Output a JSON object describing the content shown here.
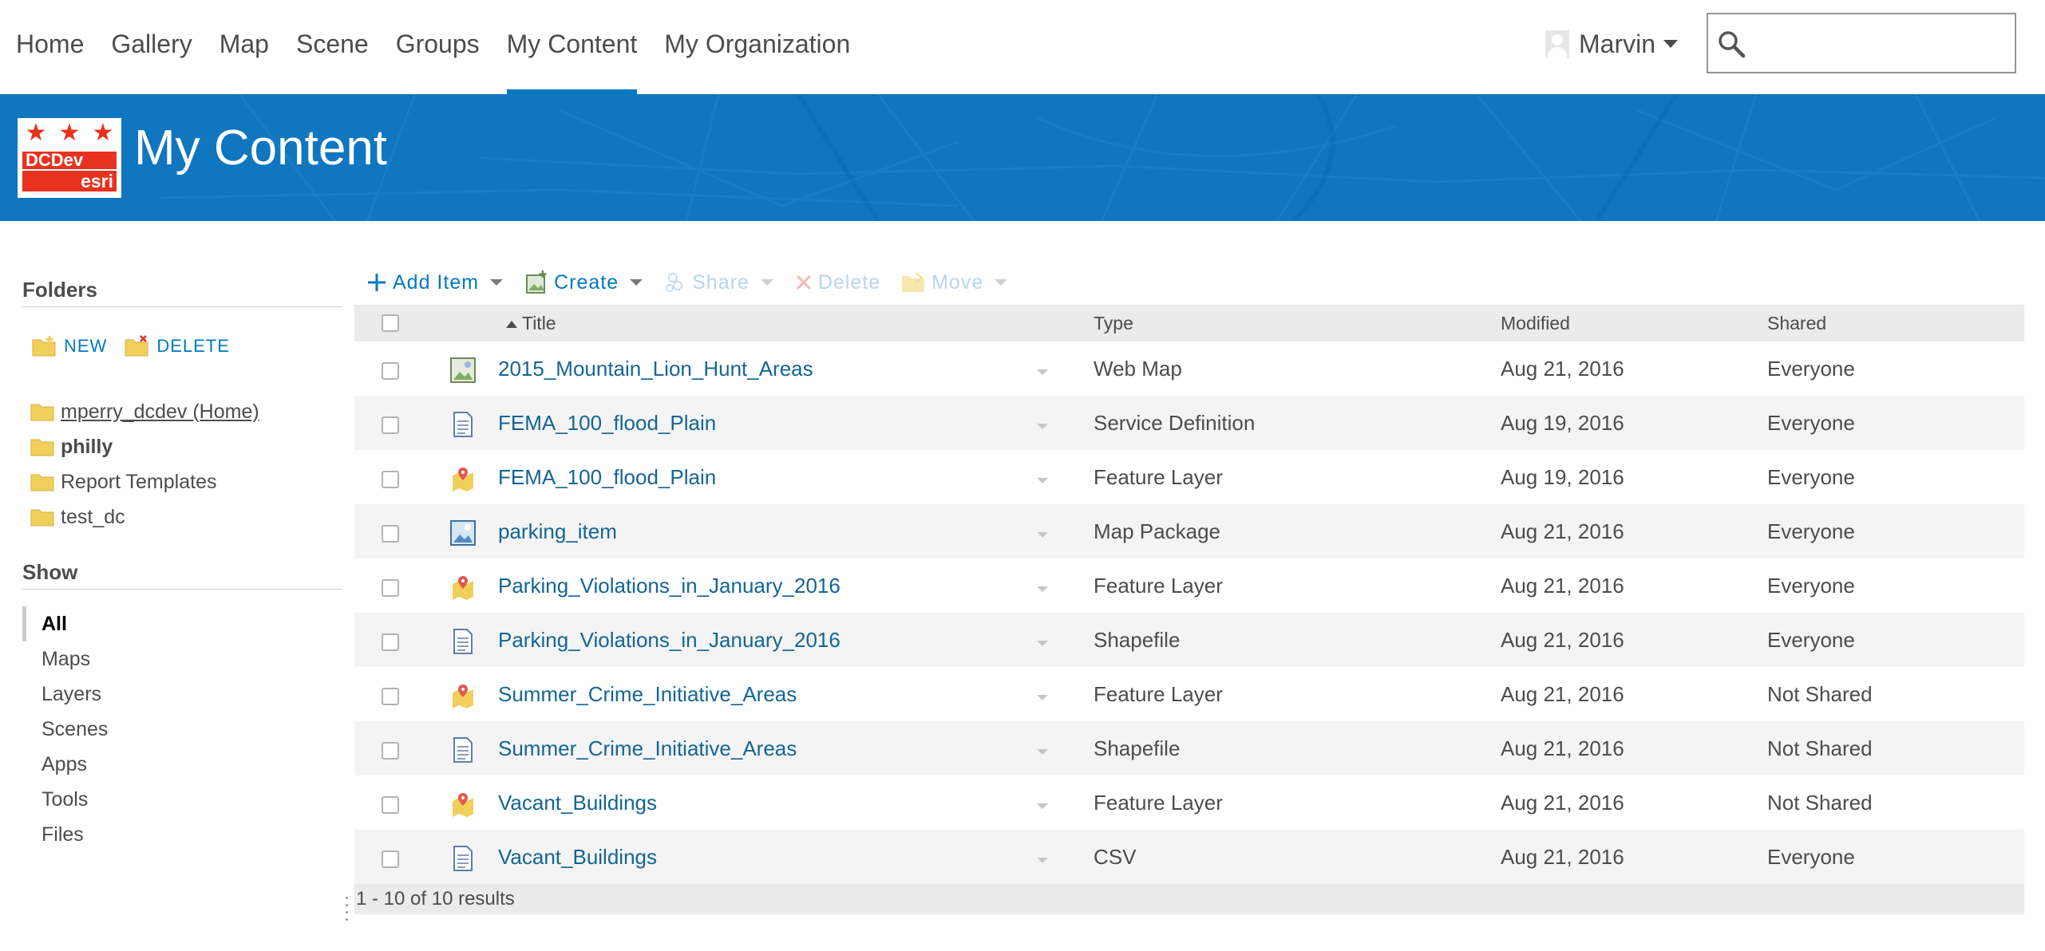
{
  "nav": {
    "items": [
      {
        "label": "Home",
        "active": false
      },
      {
        "label": "Gallery",
        "active": false
      },
      {
        "label": "Map",
        "active": false
      },
      {
        "label": "Scene",
        "active": false
      },
      {
        "label": "Groups",
        "active": false
      },
      {
        "label": "My Content",
        "active": true
      },
      {
        "label": "My Organization",
        "active": false
      }
    ],
    "user_name": "Marvin",
    "search_placeholder": ""
  },
  "banner": {
    "title": "My Content",
    "logo_line1": "DCDev",
    "logo_line2": "esri",
    "color": "#0f76bf"
  },
  "sidebar": {
    "folders_heading": "Folders",
    "new_label": "NEW",
    "delete_label": "DELETE",
    "folders": [
      {
        "label": "mperry_dcdev (Home)",
        "style": "home"
      },
      {
        "label": "philly",
        "style": "bold"
      },
      {
        "label": "Report Templates",
        "style": "normal"
      },
      {
        "label": "test_dc",
        "style": "normal"
      }
    ],
    "show_heading": "Show",
    "show_items": [
      {
        "label": "All",
        "active": true
      },
      {
        "label": "Maps",
        "active": false
      },
      {
        "label": "Layers",
        "active": false
      },
      {
        "label": "Scenes",
        "active": false
      },
      {
        "label": "Apps",
        "active": false
      },
      {
        "label": "Tools",
        "active": false
      },
      {
        "label": "Files",
        "active": false
      }
    ]
  },
  "toolbar": {
    "add_item": "Add Item",
    "create": "Create",
    "share": "Share",
    "delete": "Delete",
    "move": "Move"
  },
  "table": {
    "headers": {
      "title": "Title",
      "type": "Type",
      "modified": "Modified",
      "shared": "Shared"
    },
    "rows": [
      {
        "title": "2015_Mountain_Lion_Hunt_Areas",
        "icon": "web-map-icon",
        "type": "Web Map",
        "modified": "Aug 21, 2016",
        "shared": "Everyone"
      },
      {
        "title": "FEMA_100_flood_Plain",
        "icon": "document-icon",
        "type": "Service Definition",
        "modified": "Aug 19, 2016",
        "shared": "Everyone"
      },
      {
        "title": "FEMA_100_flood_Plain",
        "icon": "feature-layer-icon",
        "type": "Feature Layer",
        "modified": "Aug 19, 2016",
        "shared": "Everyone"
      },
      {
        "title": "parking_item",
        "icon": "map-package-icon",
        "type": "Map Package",
        "modified": "Aug 21, 2016",
        "shared": "Everyone"
      },
      {
        "title": "Parking_Violations_in_January_2016",
        "icon": "feature-layer-icon",
        "type": "Feature Layer",
        "modified": "Aug 21, 2016",
        "shared": "Everyone"
      },
      {
        "title": "Parking_Violations_in_January_2016",
        "icon": "document-icon",
        "type": "Shapefile",
        "modified": "Aug 21, 2016",
        "shared": "Everyone"
      },
      {
        "title": "Summer_Crime_Initiative_Areas",
        "icon": "feature-layer-icon",
        "type": "Feature Layer",
        "modified": "Aug 21, 2016",
        "shared": "Not Shared"
      },
      {
        "title": "Summer_Crime_Initiative_Areas",
        "icon": "document-icon",
        "type": "Shapefile",
        "modified": "Aug 21, 2016",
        "shared": "Not Shared"
      },
      {
        "title": "Vacant_Buildings",
        "icon": "feature-layer-icon",
        "type": "Feature Layer",
        "modified": "Aug 21, 2016",
        "shared": "Not Shared"
      },
      {
        "title": "Vacant_Buildings",
        "icon": "document-icon",
        "type": "CSV",
        "modified": "Aug 21, 2016",
        "shared": "Everyone"
      }
    ],
    "results_text": "1 - 10 of 10 results"
  },
  "colors": {
    "accent": "#0079c1",
    "link": "#146595",
    "header_bg": "#ebebeb",
    "row_alt": "#f4f4f4"
  }
}
